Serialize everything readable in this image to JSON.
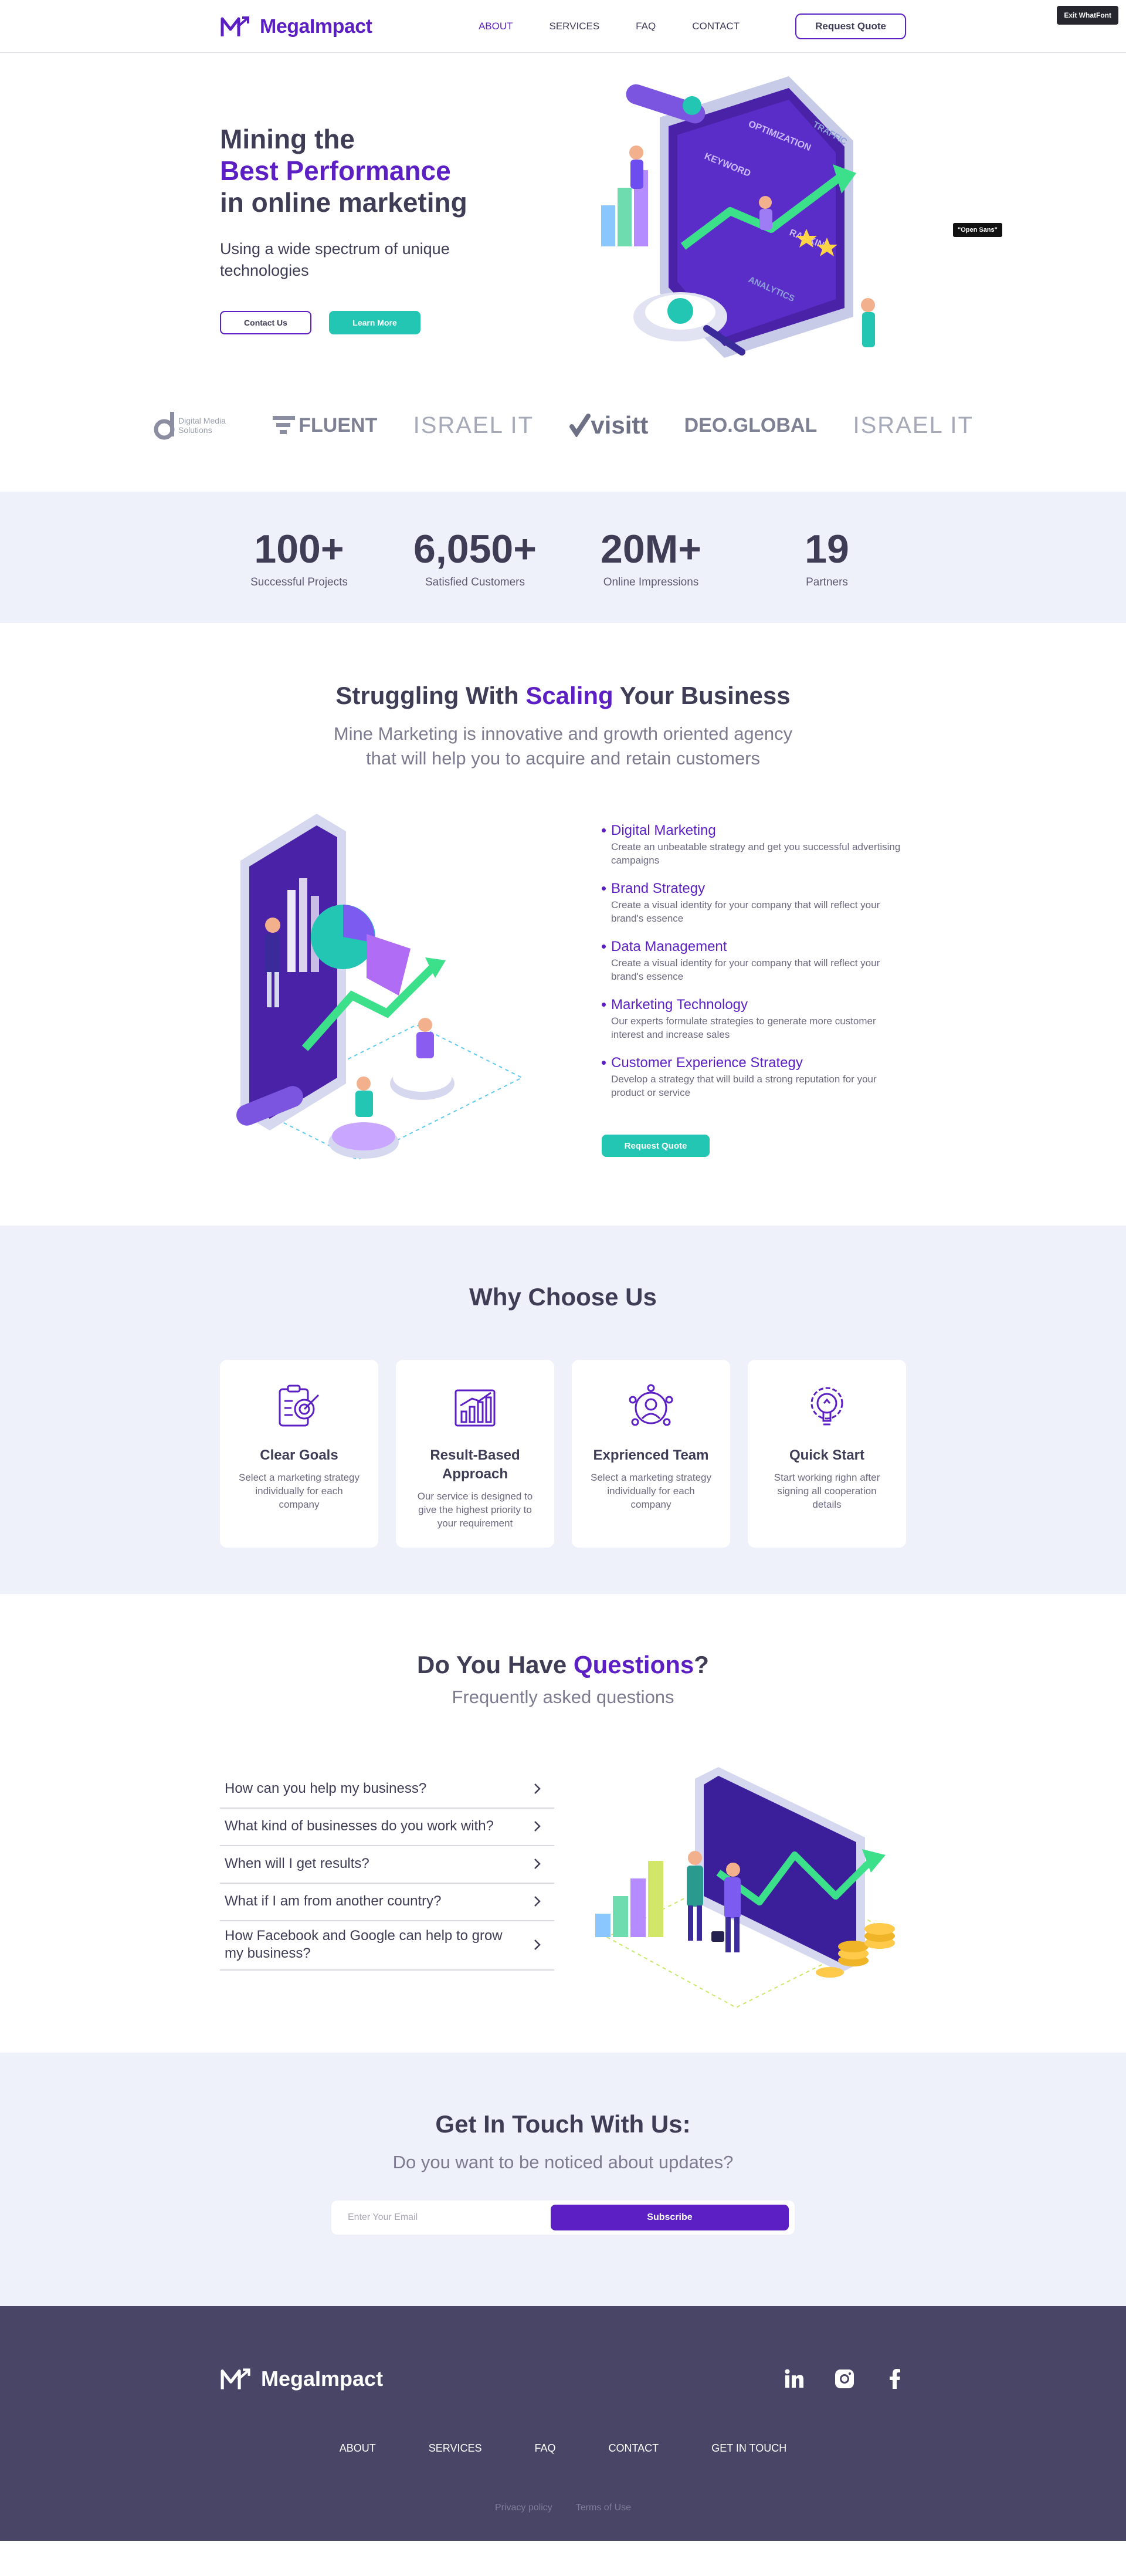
{
  "header": {
    "logo_text": "MegaImpact",
    "nav": [
      "ABOUT",
      "SERVICES",
      "FAQ",
      "CONTACT"
    ],
    "cta": "Request Quote",
    "exit_label": "Exit WhatFont"
  },
  "hero": {
    "title_line1": "Mining the",
    "title_line2": "Best Performance",
    "title_line3": "in online marketing",
    "subtitle": "Using a wide spectrum of unique technologies",
    "btn_contact": "Contact Us",
    "btn_learn": "Learn More",
    "tooltip": "\"Open Sans\"",
    "art_labels": [
      "TRAFFIC",
      "OPTIMIZATION",
      "KEYWORD",
      "RANKING",
      "ANALYTICS"
    ]
  },
  "partners": [
    "Digital Media Solutions",
    "FLUENT",
    "ISRAEL IT",
    "visitt",
    "DEO.GLOBAL",
    "ISRAEL IT"
  ],
  "stats": [
    {
      "num": "100+",
      "label": "Successful Projects"
    },
    {
      "num": "6,050+",
      "label": "Satisfied Customers"
    },
    {
      "num": "20M+",
      "label": "Online Impressions"
    },
    {
      "num": "19",
      "label": "Partners"
    }
  ],
  "scaling": {
    "title_pre": "Struggling With ",
    "title_highlight": "Scaling",
    "title_post": " Your Business",
    "subtitle": "Mine Marketing is innovative and growth oriented agency that will help you to acquire and retain customers",
    "services": [
      {
        "title": "Digital Marketing",
        "desc": "Create an unbeatable strategy and get you successful advertising campaigns"
      },
      {
        "title": "Brand Strategy",
        "desc": "Create a visual identity for your company that will reflect your brand's essence"
      },
      {
        "title": "Data Management",
        "desc": "Create a visual identity for your company that will reflect your brand's essence"
      },
      {
        "title": "Marketing Technology",
        "desc": "Our experts formulate strategies to generate more customer interest and increase sales"
      },
      {
        "title": "Customer Experience Strategy",
        "desc": "Develop a strategy that will build a strong reputation for your product or service"
      }
    ],
    "cta": "Request Quote"
  },
  "why": {
    "title": "Why Choose Us",
    "cards": [
      {
        "title": "Clear Goals",
        "desc": "Select a marketing strategy individually for each company",
        "icon": "target-clipboard-icon"
      },
      {
        "title": "Result-Based Approach",
        "desc": "Our service is designed to give the highest priority to your requirement",
        "icon": "bar-chart-icon"
      },
      {
        "title": "Exprienced Team",
        "desc": "Select a marketing strategy individually for each company",
        "icon": "team-icon"
      },
      {
        "title": "Quick Start",
        "desc": "Start working righn after signing all cooperation details",
        "icon": "lightbulb-gear-icon"
      }
    ]
  },
  "faq": {
    "title_pre": "Do You Have ",
    "title_highlight": "Questions",
    "title_post": "?",
    "subtitle": "Frequently asked questions",
    "items": [
      "How can you help my business?",
      "What kind of businesses do you work with?",
      "When will I get results?",
      "What if I am from another country?",
      "How Facebook and Google can help to grow my business?"
    ]
  },
  "touch": {
    "title": "Get In Touch With Us:",
    "subtitle": "Do you want to be noticed about updates?",
    "placeholder": "Enter Your Email",
    "button": "Subscribe"
  },
  "footer": {
    "logo_text": "MegaImpact",
    "nav": [
      "ABOUT",
      "SERVICES",
      "FAQ",
      "CONTACT",
      "GET IN TOUCH"
    ],
    "legal": [
      "Privacy policy",
      "Terms of Use"
    ]
  },
  "colors": {
    "brand": "#5b1fc4",
    "teal": "#23c6b2",
    "footer": "#484566",
    "light_bg": "#eef0fa"
  }
}
